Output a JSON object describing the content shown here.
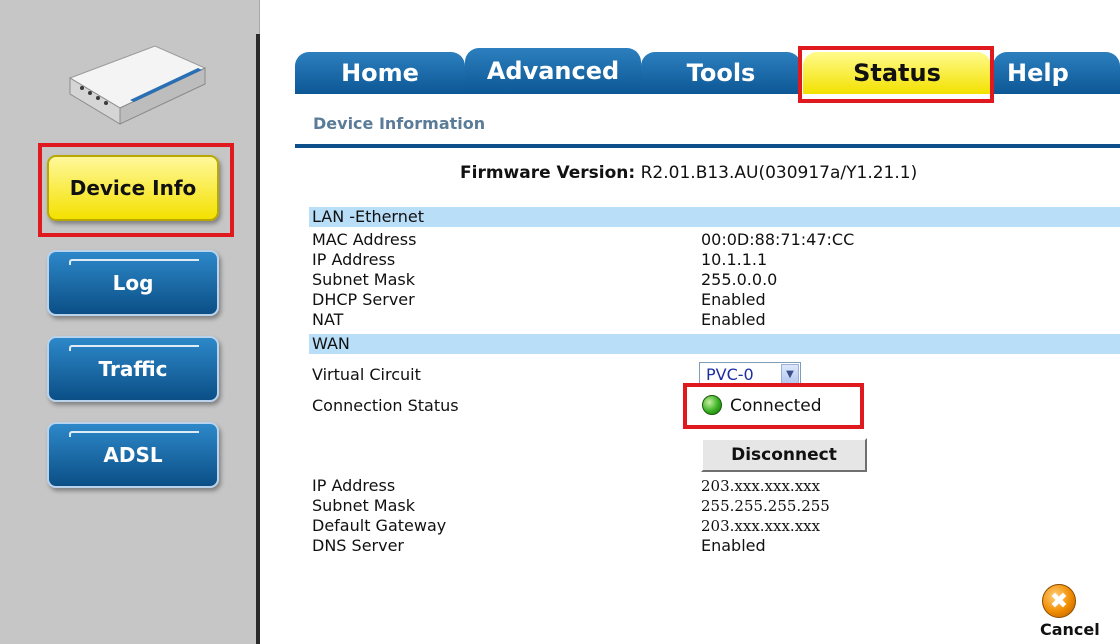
{
  "sidebar": {
    "items": [
      {
        "label": "Device Info",
        "active": true
      },
      {
        "label": "Log",
        "active": false
      },
      {
        "label": "Traffic",
        "active": false
      },
      {
        "label": "ADSL",
        "active": false
      }
    ]
  },
  "tabs": [
    {
      "label": "Home"
    },
    {
      "label": "Advanced"
    },
    {
      "label": "Tools"
    },
    {
      "label": "Status",
      "active": true
    },
    {
      "label": "Help"
    }
  ],
  "main": {
    "section_title": "Device Information",
    "firmware_label": "Firmware Version:",
    "firmware_value": "R2.01.B13.AU(030917a/Y1.21.1)",
    "lan": {
      "header": "LAN -Ethernet",
      "rows": [
        {
          "label": "MAC Address",
          "value": "00:0D:88:71:47:CC"
        },
        {
          "label": "IP Address",
          "value": "10.1.1.1"
        },
        {
          "label": "Subnet Mask",
          "value": "255.0.0.0"
        },
        {
          "label": "DHCP Server",
          "value": "Enabled"
        },
        {
          "label": "NAT",
          "value": "Enabled"
        }
      ]
    },
    "wan": {
      "header": "WAN",
      "virtual_circuit_label": "Virtual Circuit",
      "virtual_circuit_value": "PVC-0",
      "connection_status_label": "Connection Status",
      "connection_status_value": "Connected",
      "disconnect_label": "Disconnect",
      "rows": [
        {
          "label": "IP Address",
          "value": "203.xxx.xxx.xxx"
        },
        {
          "label": "Subnet Mask",
          "value": "255.255.255.255"
        },
        {
          "label": "Default Gateway",
          "value": "203.xxx.xxx.xxx"
        },
        {
          "label": "DNS Server",
          "value": "Enabled"
        }
      ]
    }
  },
  "cancel_label": "Cancel",
  "colors": {
    "tab_blue": "#0d5795",
    "active_yellow": "#f3e100",
    "band_blue": "#b9def8",
    "highlight_red": "#e0191e",
    "status_green": "#36b020"
  },
  "icons": {
    "status_led": "green-led-icon",
    "cancel": "cancel-icon",
    "device": "router-device-icon"
  }
}
